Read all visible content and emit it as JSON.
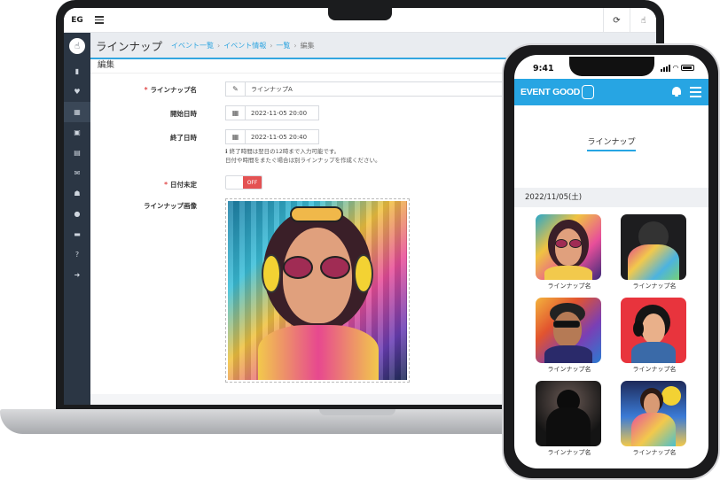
{
  "admin": {
    "brand": "EG",
    "page_title": "ラインナップ",
    "breadcrumb": [
      "イベント一覧",
      "イベント情報",
      "一覧",
      "編集"
    ],
    "card_title": "編集",
    "form": {
      "name_label": "ラインナップ名",
      "name_value": "ラインナップA",
      "start_label": "開始日時",
      "start_value": "2022-11-05 20:00",
      "end_label": "終了日時",
      "end_value": "2022-11-05 20:40",
      "end_note_1": "終了時間は翌日の12時まで入力可能です。",
      "end_note_2": "日付や時間をまたぐ場合は別ラインナップを作成ください。",
      "date_fixed_label": "日付未定",
      "date_fixed_toggle": "OFF",
      "image_label": "ラインナップ画像"
    }
  },
  "mobile": {
    "time": "9:41",
    "app_name": "EVENT GOOD",
    "section_title": "ラインナップ",
    "date_heading": "2022/11/05(土)",
    "items": [
      "ラインナップ名",
      "ラインナップ名",
      "ラインナップ名",
      "ラインナップ名",
      "ラインナップ名",
      "ラインナップ名"
    ]
  },
  "colors": {
    "accent": "#27a5e3",
    "sidebar": "#2b3644",
    "toggle_off": "#e45253"
  },
  "icons": {
    "sidebar": [
      "dashboard-icon",
      "heart-icon",
      "calendar-icon",
      "qr-icon",
      "book-icon",
      "mail-icon",
      "users-icon",
      "user-icon",
      "card-icon",
      "help-icon",
      "logout-icon"
    ]
  }
}
